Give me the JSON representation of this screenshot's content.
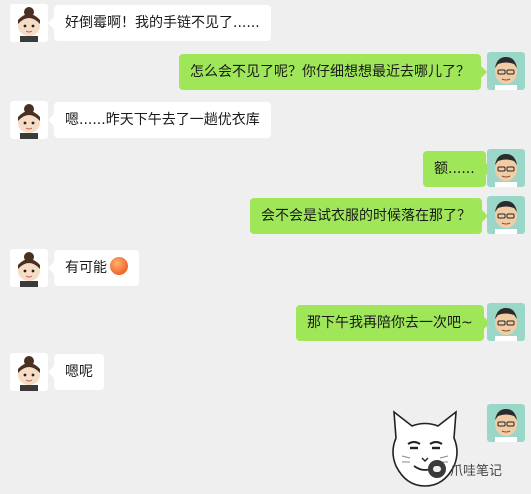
{
  "chat": {
    "messages": [
      {
        "side": "left",
        "text": "好倒霉啊！我的手链不见了......"
      },
      {
        "side": "right",
        "text": "怎么会不见了呢？你仔细想想最近去哪儿了？"
      },
      {
        "side": "left",
        "text": "嗯......昨天下午去了一趟优衣库"
      },
      {
        "side": "right",
        "text": "额......"
      },
      {
        "side": "right",
        "text": "会不会是试衣服的时候落在那了？"
      },
      {
        "side": "left",
        "text": "有可能",
        "emoji": "angry-face-emoji"
      },
      {
        "side": "right",
        "text": "那下午我再陪你去一次吧~"
      },
      {
        "side": "left",
        "text": "嗯呢"
      }
    ]
  },
  "sticker": {
    "icon": "smug-cat-face-sticker"
  },
  "watermark": {
    "text": "爪哇笔记"
  },
  "colors": {
    "background": "#efefef",
    "bubble_left": "#ffffff",
    "bubble_right": "#9fe658",
    "text": "#1a1a1a"
  }
}
